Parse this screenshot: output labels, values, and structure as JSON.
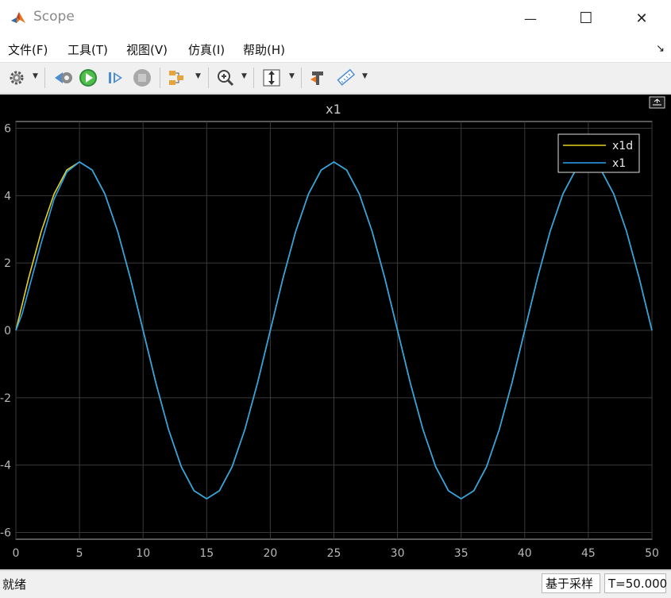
{
  "window": {
    "title": "Scope",
    "minimize": "—",
    "maximize": "☐",
    "close": "✕"
  },
  "menu": {
    "items": [
      "文件(F)",
      "工具(T)",
      "视图(V)",
      "仿真(I)",
      "帮助(H)"
    ],
    "undock": "↘"
  },
  "toolbar": {
    "icons": [
      "gear-settings-icon",
      "step-back-icon",
      "run-icon",
      "step-forward-icon",
      "stop-icon",
      "signal-selection-icon",
      "zoom-icon",
      "scale-axes-icon",
      "highlight-block-icon",
      "measurements-icon"
    ]
  },
  "status": {
    "left": "就绪",
    "mode": "基于采样",
    "time": "T=50.000"
  },
  "chart_data": {
    "type": "line",
    "title": "x1",
    "xlim": [
      0,
      50
    ],
    "ylim": [
      -6.2,
      6.2
    ],
    "xticks": [
      0,
      5,
      10,
      15,
      20,
      25,
      30,
      35,
      40,
      45,
      50
    ],
    "yticks": [
      -6,
      -4,
      -2,
      0,
      2,
      4,
      6
    ],
    "grid": true,
    "legend_position": "top-right",
    "background": "#000000",
    "axis_color": "#b0b0b0",
    "series": [
      {
        "name": "x1d",
        "color": "#e6d21a",
        "x": [
          0,
          1,
          2,
          3,
          4,
          5,
          6,
          7,
          8,
          9,
          10,
          11,
          12,
          13,
          14,
          15,
          16,
          17,
          18,
          19,
          20,
          21,
          22,
          23,
          24,
          25,
          26,
          27,
          28,
          29,
          30,
          31,
          32,
          33,
          34,
          35,
          36,
          37,
          38,
          39,
          40,
          41,
          42,
          43,
          44,
          45,
          46,
          47,
          48,
          49,
          50
        ],
        "y": [
          0,
          1.55,
          2.94,
          4.05,
          4.76,
          5,
          4.76,
          4.05,
          2.94,
          1.55,
          0,
          -1.55,
          -2.94,
          -4.05,
          -4.76,
          -5,
          -4.76,
          -4.05,
          -2.94,
          -1.55,
          0,
          1.55,
          2.94,
          4.05,
          4.76,
          5,
          4.76,
          4.05,
          2.94,
          1.55,
          0,
          -1.55,
          -2.94,
          -4.05,
          -4.76,
          -5,
          -4.76,
          -4.05,
          -2.94,
          -1.55,
          0,
          1.55,
          2.94,
          4.05,
          4.76,
          5,
          4.76,
          4.05,
          2.94,
          1.55,
          0
        ]
      },
      {
        "name": "x1",
        "color": "#2aa3ef",
        "x": [
          0,
          0.5,
          1,
          1.5,
          2,
          3,
          4,
          5,
          6,
          7,
          8,
          9,
          10,
          11,
          12,
          13,
          14,
          15,
          16,
          17,
          18,
          19,
          20,
          21,
          22,
          23,
          24,
          25,
          26,
          27,
          28,
          29,
          30,
          31,
          32,
          33,
          34,
          35,
          36,
          37,
          38,
          39,
          40,
          41,
          42,
          43,
          44,
          45,
          46,
          47,
          48,
          49,
          50
        ],
        "y": [
          0,
          0.5,
          1.2,
          1.9,
          2.6,
          3.9,
          4.7,
          5,
          4.76,
          4.05,
          2.94,
          1.55,
          0,
          -1.55,
          -2.94,
          -4.05,
          -4.76,
          -5,
          -4.76,
          -4.05,
          -2.94,
          -1.55,
          0,
          1.55,
          2.94,
          4.05,
          4.76,
          5,
          4.76,
          4.05,
          2.94,
          1.55,
          0,
          -1.55,
          -2.94,
          -4.05,
          -4.76,
          -5,
          -4.76,
          -4.05,
          -2.94,
          -1.55,
          0,
          1.55,
          2.94,
          4.05,
          4.76,
          5,
          4.76,
          4.05,
          2.94,
          1.55,
          0
        ]
      }
    ]
  }
}
